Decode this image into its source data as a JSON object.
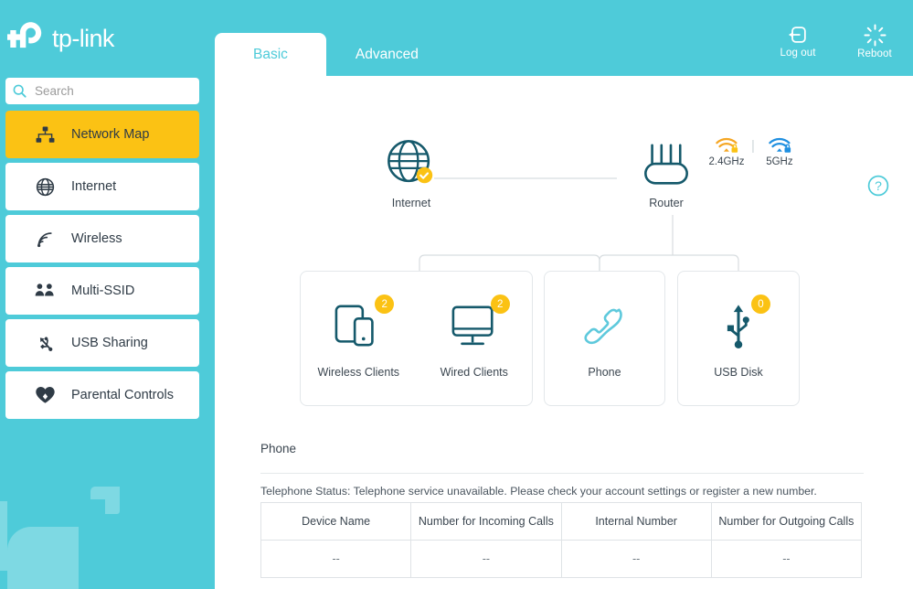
{
  "brand": {
    "name": "tp-link",
    "logo_icon": "tp-link-logo"
  },
  "search": {
    "placeholder": "Search",
    "value": "",
    "icon": "search-icon"
  },
  "sidebar": {
    "items": [
      {
        "label": "Network Map",
        "icon": "network-map-icon",
        "active": true
      },
      {
        "label": "Internet",
        "icon": "globe-icon",
        "active": false
      },
      {
        "label": "Wireless",
        "icon": "wireless-signal-icon",
        "active": false
      },
      {
        "label": "Multi-SSID",
        "icon": "multi-ssid-users-icon",
        "active": false
      },
      {
        "label": "USB Sharing",
        "icon": "usb-icon",
        "active": false
      },
      {
        "label": "Parental Controls",
        "icon": "heart-icon",
        "active": false
      }
    ]
  },
  "header": {
    "tabs": [
      {
        "label": "Basic",
        "active": true
      },
      {
        "label": "Advanced",
        "active": false
      }
    ],
    "actions": [
      {
        "label": "Log out",
        "icon": "logout-icon"
      },
      {
        "label": "Reboot",
        "icon": "reboot-icon"
      }
    ],
    "help_icon": "help-question-icon"
  },
  "topology": {
    "internet": {
      "label": "Internet",
      "icon": "globe-icon",
      "status_badge": "check-icon",
      "connected": true
    },
    "router": {
      "label": "Router",
      "icon": "router-icon"
    },
    "wifi_bands": [
      {
        "label": "2.4GHz",
        "icon": "wifi-lock-icon",
        "color": "#f5a623",
        "secured": true
      },
      {
        "label": "5GHz",
        "icon": "wifi-lock-icon",
        "color": "#1f8fe0",
        "secured": true
      }
    ],
    "wifi_separator": "|",
    "cards": [
      {
        "group": "clients",
        "tiles": [
          {
            "label": "Wireless Clients",
            "icon": "tablet-phone-icon",
            "count": "2"
          },
          {
            "label": "Wired Clients",
            "icon": "monitor-icon",
            "count": "2"
          }
        ]
      },
      {
        "group": "phone",
        "tiles": [
          {
            "label": "Phone",
            "icon": "phone-handset-icon",
            "count": null
          }
        ]
      },
      {
        "group": "usb",
        "tiles": [
          {
            "label": "USB Disk",
            "icon": "usb-icon",
            "count": "0"
          }
        ]
      }
    ]
  },
  "phone_section": {
    "title": "Phone",
    "status": "Telephone Status: Telephone service unavailable. Please check your account settings or register a new number.",
    "table": {
      "columns": [
        "Device Name",
        "Number for Incoming Calls",
        "Internal Number",
        "Number for Outgoing Calls"
      ],
      "rows": [
        [
          "--",
          "--",
          "--",
          "--"
        ]
      ]
    }
  },
  "colors": {
    "brand_teal": "#4ecbd9",
    "accent_amber": "#fbc214",
    "dark_teal": "#145566",
    "light_teal_icon": "#5ec9dc"
  }
}
